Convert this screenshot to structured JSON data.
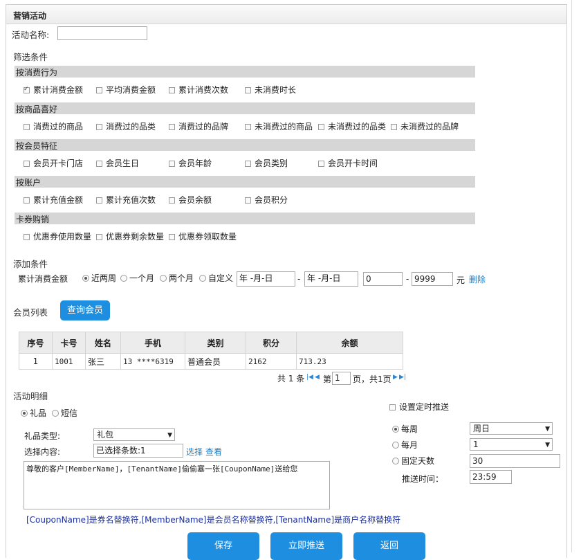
{
  "header": {
    "title": "营销活动"
  },
  "activity_name": {
    "label": "活动名称:",
    "value": ""
  },
  "filter": {
    "title": "筛选条件",
    "groups": [
      {
        "title": "按消费行为",
        "options": [
          {
            "label": "累计消费金额",
            "checked": true
          },
          {
            "label": "平均消费金额",
            "checked": false
          },
          {
            "label": "累计消费次数",
            "checked": false
          },
          {
            "label": "未消费时长",
            "checked": false
          }
        ]
      },
      {
        "title": "按商品喜好",
        "options": [
          {
            "label": "消费过的商品",
            "checked": false
          },
          {
            "label": "消费过的品类",
            "checked": false
          },
          {
            "label": "消费过的品牌",
            "checked": false
          },
          {
            "label": "未消费过的商品",
            "checked": false
          },
          {
            "label": "未消费过的品类",
            "checked": false
          },
          {
            "label": "未消费过的品牌",
            "checked": false
          }
        ]
      },
      {
        "title": "按会员特征",
        "options": [
          {
            "label": "会员开卡门店",
            "checked": false
          },
          {
            "label": "会员生日",
            "checked": false
          },
          {
            "label": "会员年龄",
            "checked": false
          },
          {
            "label": "会员类别",
            "checked": false
          },
          {
            "label": "会员开卡时间",
            "checked": false
          }
        ]
      },
      {
        "title": "按账户",
        "options": [
          {
            "label": "累计充值金额",
            "checked": false
          },
          {
            "label": "累计充值次数",
            "checked": false
          },
          {
            "label": "会员余额",
            "checked": false
          },
          {
            "label": "会员积分",
            "checked": false
          }
        ]
      },
      {
        "title": "卡券购销",
        "options": [
          {
            "label": "优惠券使用数量",
            "checked": false
          },
          {
            "label": "优惠券剩余数量",
            "checked": false
          },
          {
            "label": "优惠券领取数量",
            "checked": false
          }
        ]
      }
    ]
  },
  "add_condition": {
    "title": "添加条件",
    "row_label": "累计消费金额",
    "periods": [
      {
        "label": "近两周",
        "selected": true
      },
      {
        "label": "一个月",
        "selected": false
      },
      {
        "label": "两个月",
        "selected": false
      },
      {
        "label": "自定义",
        "selected": false
      }
    ],
    "date_from": "年 -月-日",
    "dash": "-",
    "date_to": "年 -月-日",
    "min": "0",
    "max": "9999",
    "unit": "元",
    "delete_label": "删除"
  },
  "members": {
    "title": "会员列表",
    "query_button": "查询会员",
    "columns": [
      "序号",
      "卡号",
      "姓名",
      "手机",
      "类别",
      "积分",
      "余额"
    ],
    "rows": [
      [
        "1",
        "1001",
        "张三",
        "13 ****6319",
        "普通会员",
        "2162",
        "713.23"
      ]
    ],
    "pagination": {
      "total": "共 1 条",
      "page_prefix": "第",
      "page": "1",
      "page_suffix": "页，共1页"
    }
  },
  "detail": {
    "title": "活动明细",
    "types": [
      {
        "label": "礼品",
        "selected": true
      },
      {
        "label": "短信",
        "selected": false
      }
    ],
    "gift_type_label": "礼品类型:",
    "gift_type_value": "礼包",
    "content_label": "选择内容:",
    "content_value": "已选择条数:1",
    "select_link": "选择",
    "view_link": "查看",
    "message": "尊敬的客户[MemberName]，[TenantName]偷偷塞一张[CouponName]送给您",
    "hint": "[CouponName]是券名替换符,[MemberName]是会员名称替换符,[TenantName]是商户名称替换符"
  },
  "schedule": {
    "enable_label": "设置定时推送",
    "enabled": false,
    "weekly_label": "每周",
    "weekly_value": "周日",
    "monthly_label": "每月",
    "monthly_value": "1",
    "fixed_label": "固定天数",
    "fixed_value": "30",
    "time_label": "推送时间：",
    "time_value": "23:59",
    "selected": "weekly"
  },
  "actions": {
    "save": "保存",
    "push_now": "立即推送",
    "back": "返回"
  },
  "colors": {
    "accent": "#1e8fe0",
    "bar": "#d6d6d6",
    "hint": "#1a2f9e",
    "link": "#1a7bc4"
  }
}
